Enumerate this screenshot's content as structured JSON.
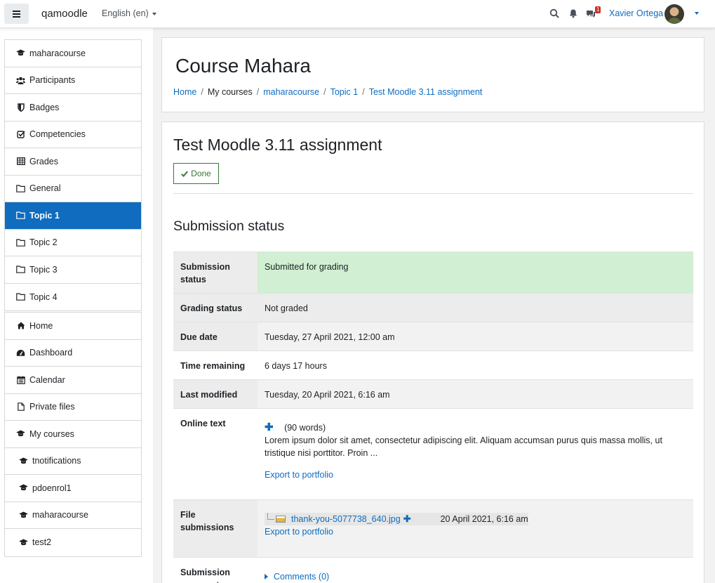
{
  "navbar": {
    "site_name": "qamoodle",
    "language": "English (en)",
    "message_count": "1",
    "user_name": "Xavier Ortega"
  },
  "sidebar": {
    "course_nav": [
      {
        "label": "maharacourse",
        "icon": "graduation-cap-icon"
      },
      {
        "label": "Participants",
        "icon": "users-icon"
      },
      {
        "label": "Badges",
        "icon": "shield-icon"
      },
      {
        "label": "Competencies",
        "icon": "check-square-icon"
      },
      {
        "label": "Grades",
        "icon": "table-icon"
      }
    ],
    "sections": [
      {
        "label": "General",
        "icon": "folder-icon"
      },
      {
        "label": "Topic 1",
        "icon": "folder-icon",
        "active": true
      },
      {
        "label": "Topic 2",
        "icon": "folder-icon"
      },
      {
        "label": "Topic 3",
        "icon": "folder-icon"
      },
      {
        "label": "Topic 4",
        "icon": "folder-icon"
      }
    ],
    "site_nav": [
      {
        "label": "Home",
        "icon": "home-icon"
      },
      {
        "label": "Dashboard",
        "icon": "dashboard-icon"
      },
      {
        "label": "Calendar",
        "icon": "calendar-icon"
      },
      {
        "label": "Private files",
        "icon": "file-icon"
      }
    ],
    "my_courses": {
      "label": "My courses",
      "items": [
        "tnotifications",
        "pdoenrol1",
        "maharacourse",
        "test2"
      ]
    }
  },
  "header": {
    "title": "Course Mahara",
    "breadcrumb": [
      "Home",
      "My courses",
      "maharacourse",
      "Topic 1",
      "Test Moodle 3.11 assignment"
    ]
  },
  "assignment": {
    "title": "Test Moodle 3.11 assignment",
    "done_label": "Done",
    "section_heading": "Submission status",
    "rows": {
      "submission_status": {
        "label": "Submission status",
        "value": "Submitted for grading"
      },
      "grading_status": {
        "label": "Grading status",
        "value": "Not graded"
      },
      "due_date": {
        "label": "Due date",
        "value": "Tuesday, 27 April 2021, 12:00 am"
      },
      "time_remaining": {
        "label": "Time remaining",
        "value": "6 days 17 hours"
      },
      "last_modified": {
        "label": "Last modified",
        "value": "Tuesday, 20 April 2021, 6:16 am"
      },
      "online_text": {
        "label": "Online text",
        "word_count": "(90 words)",
        "excerpt": "Lorem ipsum dolor sit amet, consectetur adipiscing elit. Aliquam accumsan purus quis massa mollis, ut tristique nisi porttitor. Proin ...",
        "export": "Export to portfolio"
      },
      "file_submissions": {
        "label": "File submissions",
        "file_name": "thank-you-5077738_640.jpg",
        "file_date": "20 April 2021, 6:16 am",
        "export": "Export to portfolio"
      },
      "submission_comments": {
        "label": "Submission comments",
        "link": "Comments (0)"
      }
    }
  },
  "colors": {
    "primary": "#0f6cbf",
    "success": "#357a32",
    "submitted_bg": "#d1efd2",
    "badge": "#ca3120"
  }
}
